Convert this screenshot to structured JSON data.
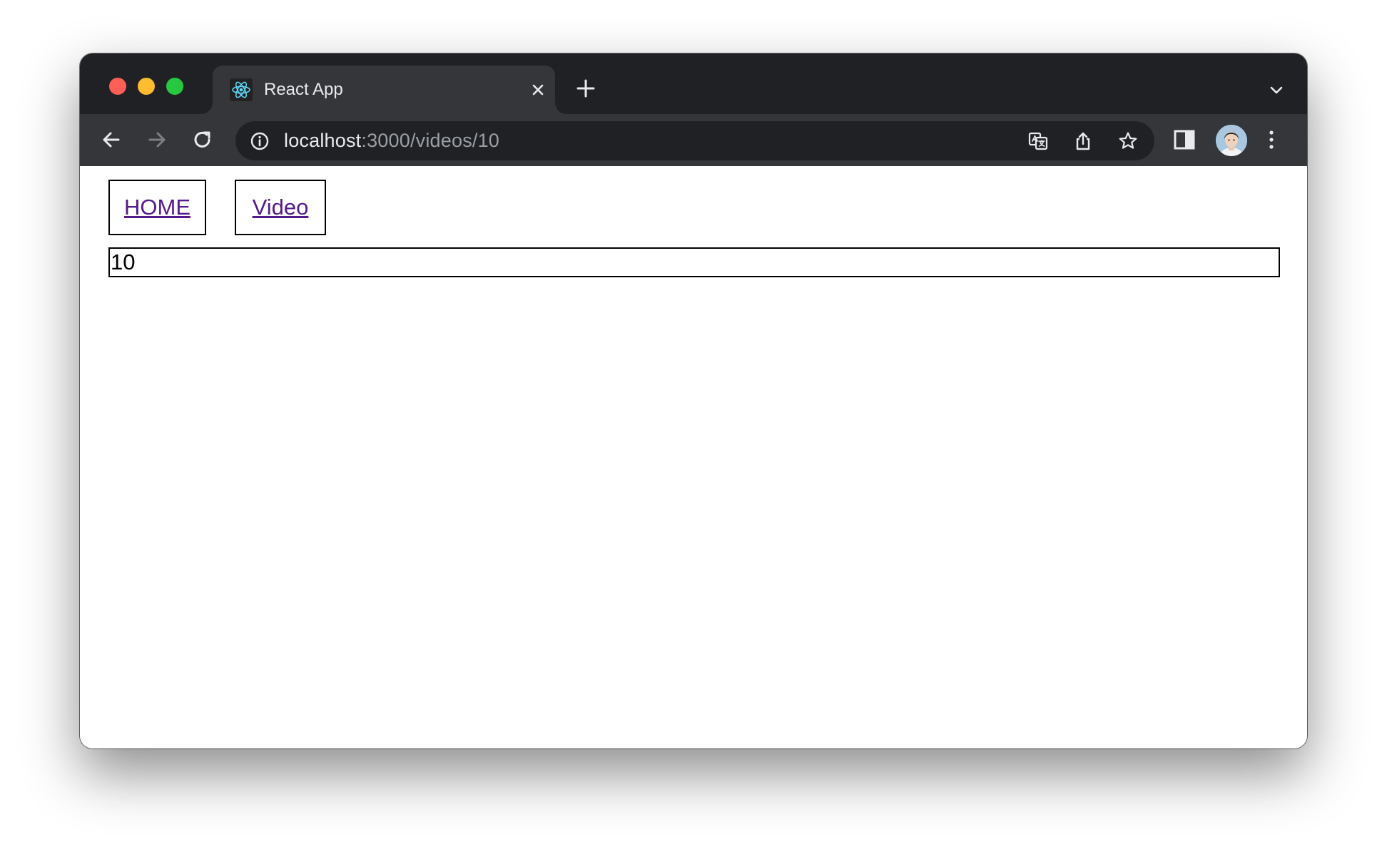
{
  "browser": {
    "tab": {
      "title": "React App",
      "favicon": "react-logo-icon"
    },
    "address_bar": {
      "host": "localhost",
      "path": ":3000/videos/10"
    },
    "colors": {
      "tabstrip": "#202124",
      "toolbar": "#35363a",
      "omnibox": "#202124",
      "traffic_red": "#ff5f57",
      "traffic_yellow": "#febc2e",
      "traffic_green": "#28c840"
    }
  },
  "page": {
    "nav": {
      "home_label": "HOME",
      "video_label": "Video"
    },
    "video_id": "10",
    "colors": {
      "visited_link": "#551a8b",
      "border": "#000000"
    }
  }
}
